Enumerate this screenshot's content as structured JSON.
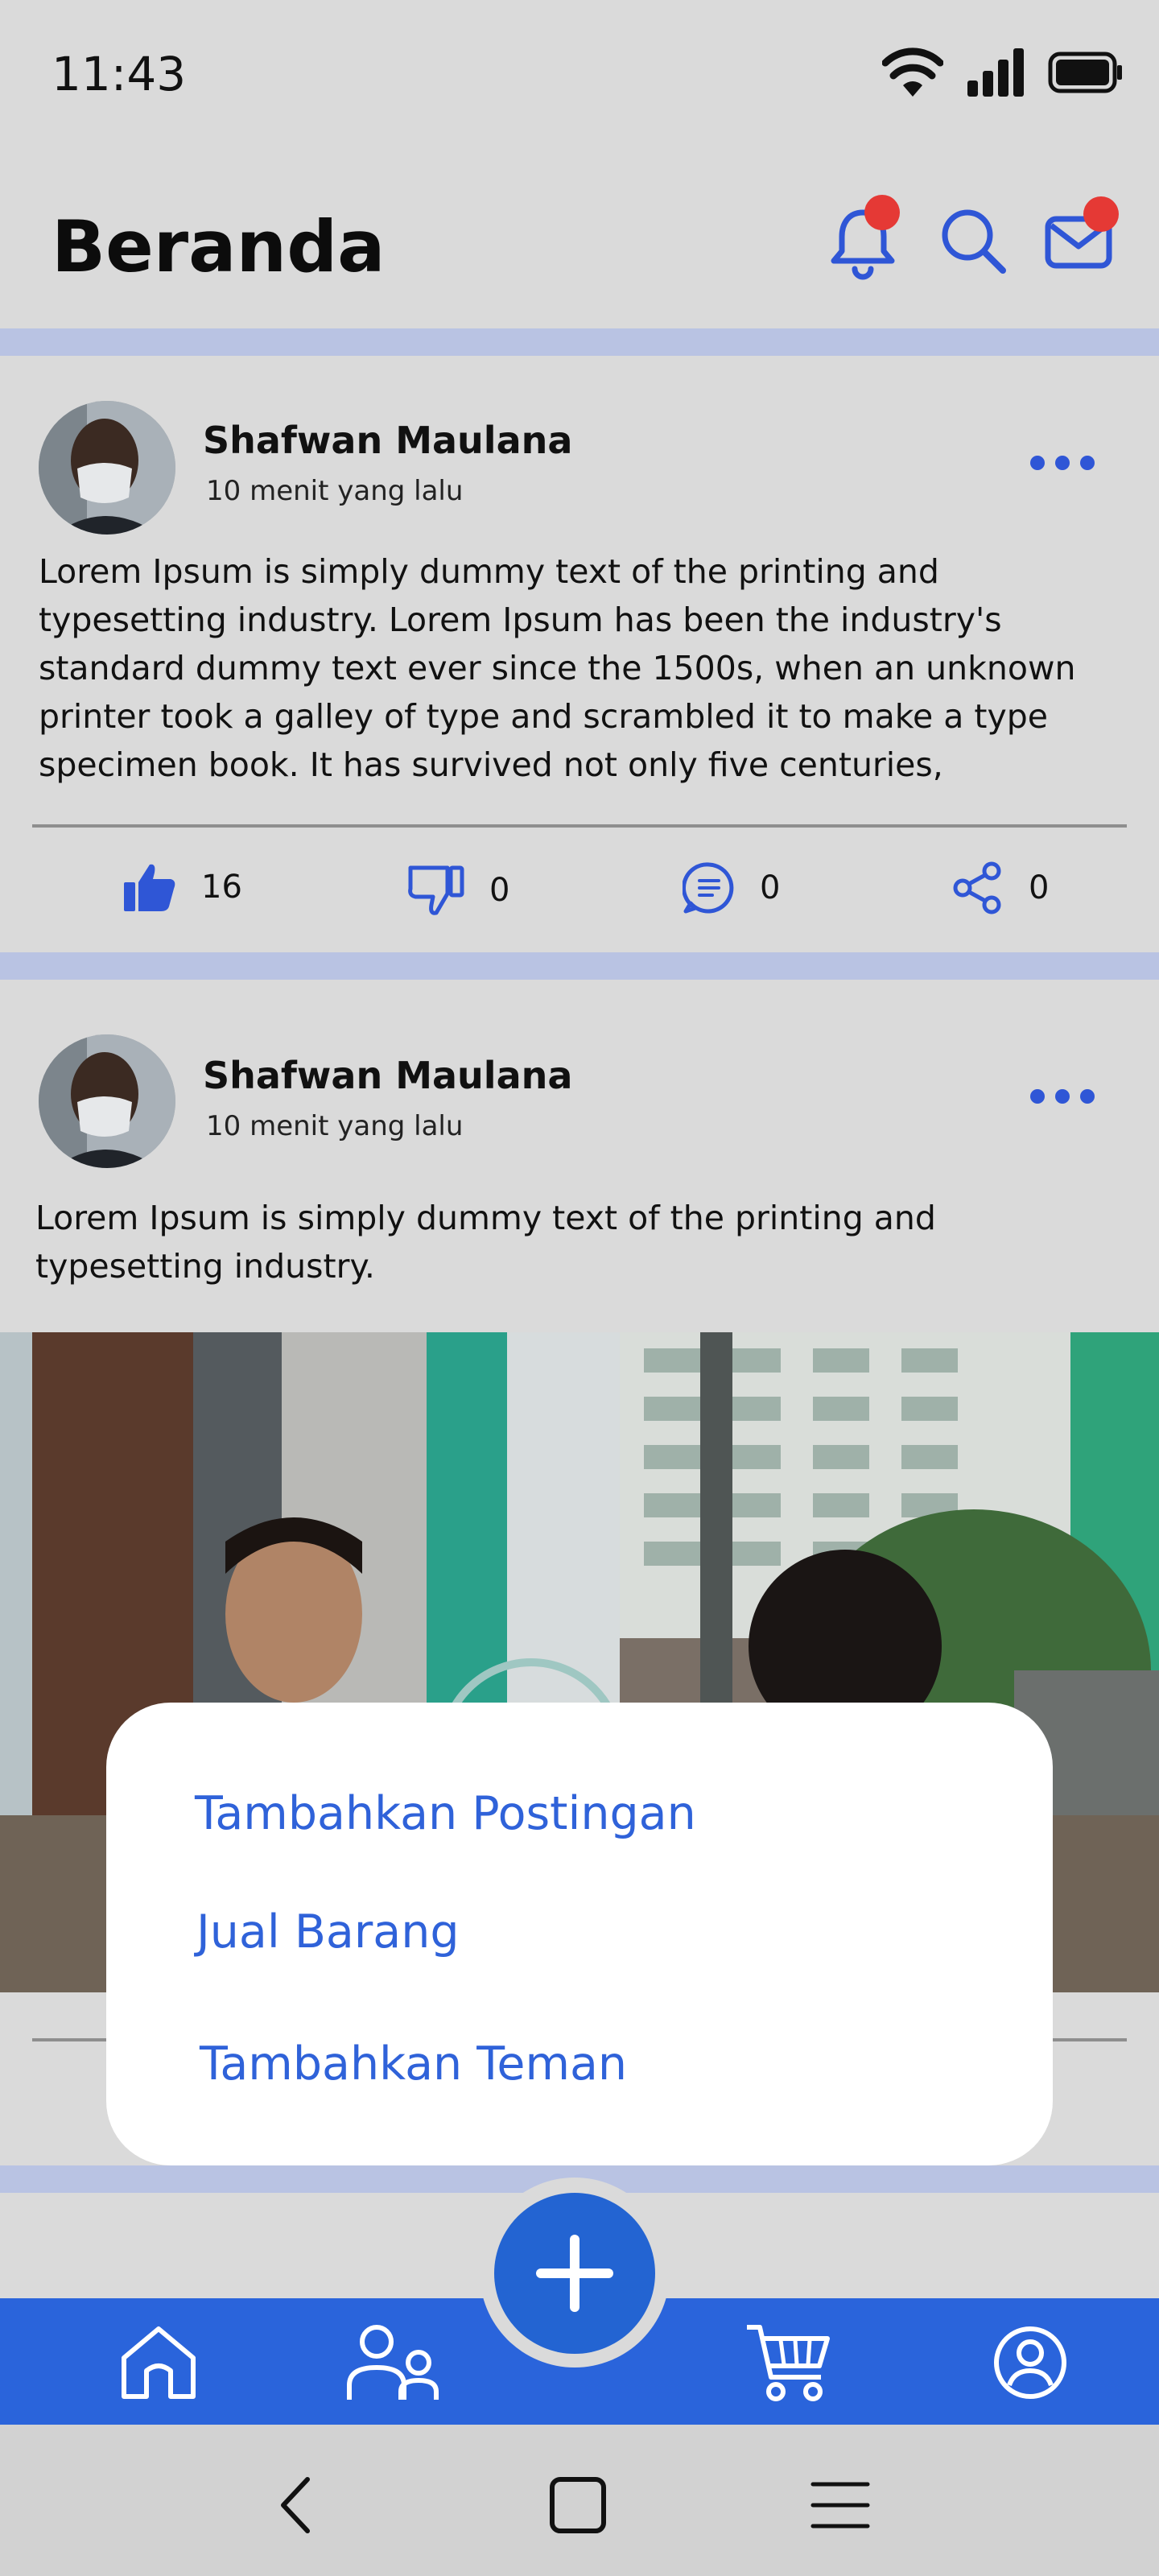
{
  "status_bar": {
    "time": "11:43",
    "icons": [
      "wifi-icon",
      "signal-icon",
      "battery-icon"
    ]
  },
  "header": {
    "title": "Beranda",
    "icons": [
      "bell-icon",
      "search-icon",
      "mail-icon"
    ]
  },
  "posts": [
    {
      "author": "Shafwan Maulana",
      "time": "10 menit yang lalu",
      "body": "Lorem Ipsum is simply dummy text of the printing and typesetting industry. Lorem Ipsum has been the industry's standard dummy text ever since the 1500s, when an unknown printer took a galley of type and scrambled it to make a type specimen book. It has survived not only five centuries,",
      "likes": "16",
      "dislikes": "0",
      "comments": "0",
      "shares": "0"
    },
    {
      "author": "Shafwan Maulana",
      "time": "10 menit yang lalu",
      "body": "Lorem Ipsum is simply dummy text of the printing and typesetting industry."
    }
  ],
  "popup_menu": {
    "items": [
      "Tambahkan Postingan",
      "Jual Barang",
      "Tambahkan Teman"
    ]
  },
  "bottom_nav": {
    "items": [
      "home-icon",
      "friends-icon",
      "add-icon",
      "cart-icon",
      "profile-icon"
    ]
  },
  "system_nav": {
    "items": [
      "back-icon",
      "home-square-icon",
      "menu-icon"
    ]
  },
  "colors": {
    "accent": "#2f56d6",
    "nav_bar": "#2a64db",
    "notification": "#e53935",
    "divider": "#b9c3e3"
  }
}
